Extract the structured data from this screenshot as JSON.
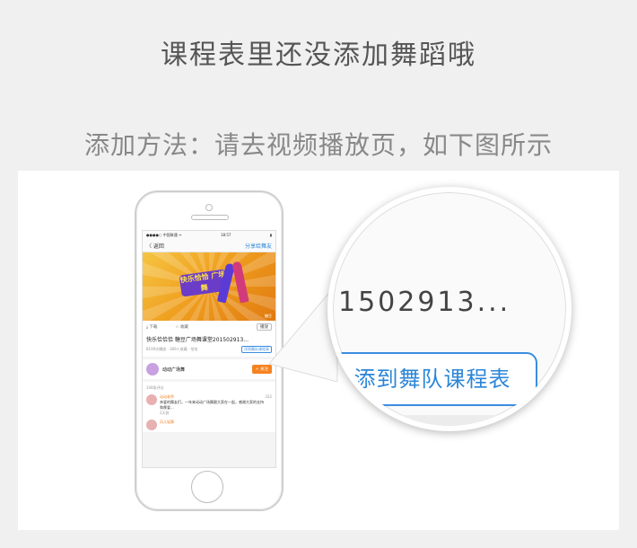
{
  "header": {
    "title": "课程表里还没添加舞蹈哦",
    "method": "添加方法：请去视频播放页，如下图所示"
  },
  "phone": {
    "status": {
      "carrier": "●●●●○ 中国联通 ᯤ",
      "time": "18:57",
      "battery": "▮"
    },
    "nav": {
      "back": "〈 返回",
      "share": "分享给舞友"
    },
    "video": {
      "logo": "快乐恰恰 广场舞",
      "watermark": "糖豆"
    },
    "actions": {
      "download": "下载",
      "favorite": "收藏",
      "replay": "播放"
    },
    "video_title": "快乐恰恰恰 糖豆广场舞课堂201502913...",
    "video_meta": "8199次播放 · 389人收藏 · 恰恰",
    "add_button_small": "添到舞队课程表",
    "team": {
      "name": "动动广场舞",
      "follow": "+ 关注"
    },
    "comment_count": "348条评论",
    "comments": [
      {
        "name": "动动老师",
        "text": "亲爱的舞友们，一年来动动广场舞跟大家在一起，感谢大家的支持和厚爱...",
        "likes": "332",
        "time": "2天前"
      },
      {
        "name": "风儿轻舞",
        "text": "",
        "likes": "",
        "time": ""
      }
    ]
  },
  "magnifier": {
    "title_fragment": "1502913...",
    "add_button": "添到舞队课程表"
  }
}
